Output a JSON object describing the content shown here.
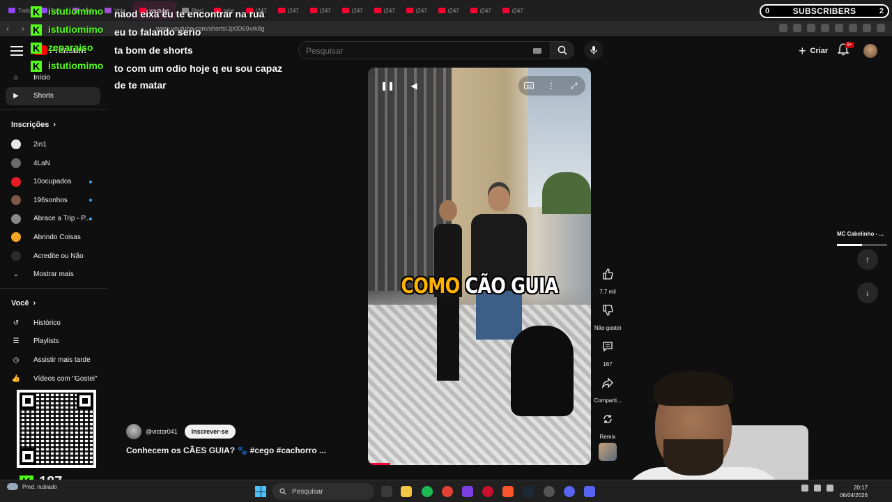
{
  "browser": {
    "tabs": [
      {
        "label": "Twitc"
      },
      {
        "label": "Twit"
      },
      {
        "label": "Midj"
      },
      {
        "label": "Vola"
      },
      {
        "label": "youtube",
        "active": true
      },
      {
        "label": "Blacl"
      },
      {
        "label": "tabe"
      },
      {
        "label": "(247"
      },
      {
        "label": "(247"
      },
      {
        "label": "(247"
      },
      {
        "label": "(247"
      },
      {
        "label": "(247"
      },
      {
        "label": "(247"
      },
      {
        "label": "(247"
      },
      {
        "label": "(247"
      },
      {
        "label": "(247"
      }
    ],
    "url": "www.youtube.com/shorts/Jp0D69xrk8g"
  },
  "youtube": {
    "logo_text": "Premium",
    "search_placeholder": "Pesquisar",
    "create_label": "Criar",
    "notification_badge": "9+"
  },
  "sidebar": {
    "main": [
      {
        "label": "Início",
        "icon": "home-icon"
      },
      {
        "label": "Shorts",
        "icon": "shorts-icon",
        "active": true
      }
    ],
    "subs_header": "Inscrições",
    "subscriptions": [
      {
        "label": "2in1",
        "color": "#e8e8e8",
        "live": false
      },
      {
        "label": "4LaN",
        "color": "#6b6b6b",
        "live": false
      },
      {
        "label": "10ocupados",
        "color": "#e81c24",
        "live": true
      },
      {
        "label": "196sonhos",
        "color": "#7d5a4a",
        "live": true
      },
      {
        "label": "Abrace a Trip - P...",
        "color": "#8a8a8a",
        "live": true
      },
      {
        "label": "Abrindo Coisas",
        "color": "#f5a623",
        "live": false
      },
      {
        "label": "Acredite ou Não",
        "color": "#2c2c2c",
        "live": false
      }
    ],
    "show_more": "Mostrar mais",
    "you_header": "Você",
    "you": [
      {
        "label": "Histórico",
        "icon": "history-icon"
      },
      {
        "label": "Playlists",
        "icon": "playlists-icon"
      },
      {
        "label": "Assistir mais tarde",
        "icon": "watch-later-icon"
      },
      {
        "label": "Vídeos com \"Gostei\"",
        "icon": "liked-icon"
      }
    ]
  },
  "chat": [
    {
      "user": "istutiomimo",
      "message": "naod eixa eu te encontrar na rua"
    },
    {
      "user": "istutiomimo",
      "message": "eu to falando serio"
    },
    {
      "user": "zeparaiso",
      "message": "ta bom de shorts"
    },
    {
      "user": "istutiomimo",
      "message": "to com um odio hoje q eu sou capaz de te matar"
    }
  ],
  "video": {
    "caption_highlight": "COMO",
    "caption_rest": "CÃO GUIA",
    "progress": 0.1,
    "channel": "@victor041",
    "subscribe_label": "Inscrever-se",
    "title": "Conhecem os CÃES GUIA? 🐾 #cego #cachorro ..."
  },
  "actions": {
    "likes": "7,7 mil",
    "dislike": "Não gostei",
    "comments": "167",
    "share": "Comparti...",
    "remix": "Remix"
  },
  "overlay": {
    "sub_goal_count": "0",
    "sub_goal_label": "SUBSCRIBERS",
    "sub_goal_target": "2",
    "now_playing": "MC Cabelinho - ...",
    "now_playing_progress": 0.5,
    "kick_count": "187",
    "accent": "#53fc18"
  },
  "taskbar": {
    "weather": "Pred. nublado",
    "search": "Pesquisar",
    "time": "20:17",
    "date": "06/04/2026"
  }
}
